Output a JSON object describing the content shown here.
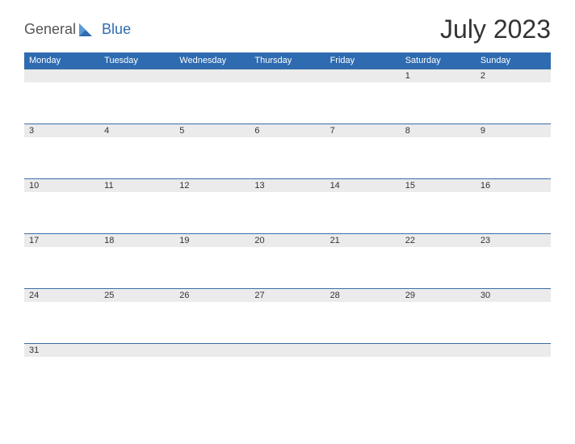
{
  "brand": {
    "word1": "General",
    "word2": "Blue"
  },
  "title": "July 2023",
  "days": [
    "Monday",
    "Tuesday",
    "Wednesday",
    "Thursday",
    "Friday",
    "Saturday",
    "Sunday"
  ],
  "weeks": [
    [
      "",
      "",
      "",
      "",
      "",
      "1",
      "2"
    ],
    [
      "3",
      "4",
      "5",
      "6",
      "7",
      "8",
      "9"
    ],
    [
      "10",
      "11",
      "12",
      "13",
      "14",
      "15",
      "16"
    ],
    [
      "17",
      "18",
      "19",
      "20",
      "21",
      "22",
      "23"
    ],
    [
      "24",
      "25",
      "26",
      "27",
      "28",
      "29",
      "30"
    ],
    [
      "31",
      "",
      "",
      "",
      "",
      "",
      ""
    ]
  ]
}
